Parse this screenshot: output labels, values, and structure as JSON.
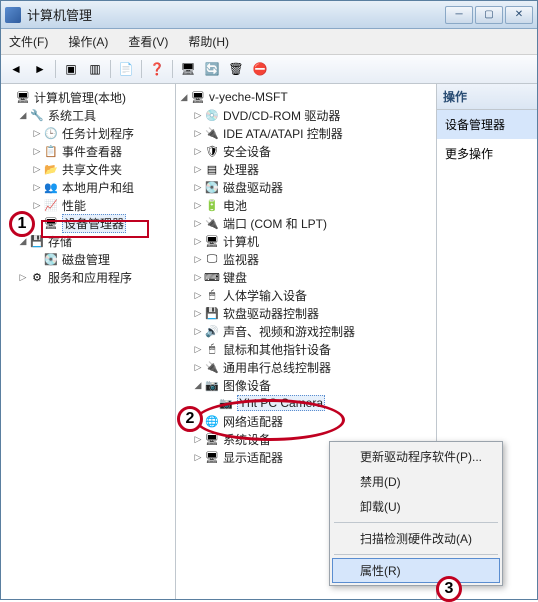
{
  "window": {
    "title": "计算机管理"
  },
  "menu": {
    "file": "文件(F)",
    "action": "操作(A)",
    "view": "查看(V)",
    "help": "帮助(H)"
  },
  "left_tree": {
    "root": "计算机管理(本地)",
    "system_tools": "系统工具",
    "task_scheduler": "任务计划程序",
    "event_viewer": "事件查看器",
    "shared_folders": "共享文件夹",
    "local_users": "本地用户和组",
    "performance": "性能",
    "device_manager": "设备管理器",
    "storage": "存储",
    "disk_mgmt": "磁盘管理",
    "services": "服务和应用程序"
  },
  "center_tree": {
    "host": "v-yeche-MSFT",
    "dvd": "DVD/CD-ROM 驱动器",
    "ide": "IDE ATA/ATAPI 控制器",
    "security": "安全设备",
    "cpu": "处理器",
    "disk": "磁盘驱动器",
    "battery": "电池",
    "ports": "端口 (COM 和 LPT)",
    "computer": "计算机",
    "monitor": "监视器",
    "keyboard": "键盘",
    "hid": "人体学输入设备",
    "fdc": "软盘驱动器控制器",
    "sound": "声音、视频和游戏控制器",
    "mouse": "鼠标和其他指针设备",
    "usb": "通用串行总线控制器",
    "imaging": "图像设备",
    "camera": "Yht PC Camera",
    "network": "网络适配器",
    "system": "系统设备",
    "display": "显示适配器"
  },
  "right": {
    "header": "操作",
    "sel": "设备管理器",
    "more": "更多操作"
  },
  "context_menu": {
    "update": "更新驱动程序软件(P)...",
    "disable": "禁用(D)",
    "uninstall": "卸载(U)",
    "scan": "扫描检测硬件改动(A)",
    "properties": "属性(R)"
  },
  "annotations": {
    "one": "1",
    "two": "2",
    "three": "3"
  }
}
